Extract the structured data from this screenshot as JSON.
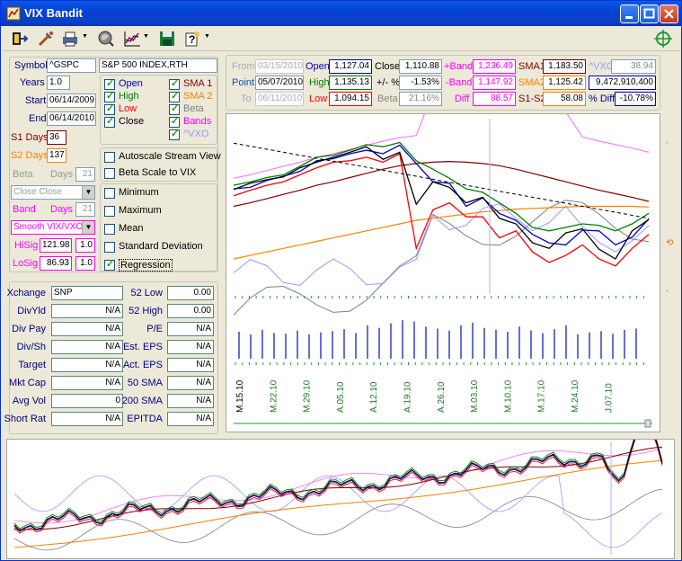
{
  "window": {
    "title": "VIX Bandit"
  },
  "toolbar": {
    "icons": [
      "exit-icon",
      "tools-icon",
      "print-icon",
      "search-globe-icon",
      "chart-icon",
      "save-icon",
      "help-icon",
      "compass-icon"
    ]
  },
  "inputs": {
    "symbol_label": "Symbol",
    "symbol": "^GSPC",
    "name": "S&P 500 INDEX,RTH",
    "years_label": "Years",
    "years": "1.0",
    "start_label": "Start",
    "start": "06/14/2009",
    "end_label": "End",
    "end": "06/14/2010",
    "s1days_label": "S1 Days",
    "s1days": "36",
    "s2days_label": "S2 Days",
    "s2days": "137",
    "beta_label": "Beta",
    "beta_days_label": "Days",
    "beta_days": "21",
    "close_select": "Close Close",
    "band_label": "Band",
    "band_days_label": "Days",
    "band_days": "21",
    "smooth_select": "Smooth VIX/VXO",
    "hisig_label": "HiSig",
    "hisig": "121.98",
    "hisig_mult": "1.0",
    "losig_label": "LoSig",
    "losig": "86.93",
    "losig_mult": "1.0"
  },
  "checks_col1": [
    {
      "label": "Open",
      "on": true,
      "color": "#0000cc"
    },
    {
      "label": "High",
      "on": true,
      "color": "#008000"
    },
    {
      "label": "Low",
      "on": true,
      "color": "#ff0000"
    },
    {
      "label": "Close",
      "on": true,
      "color": "#000000"
    }
  ],
  "checks_col2": [
    {
      "label": "SMA 1",
      "on": true,
      "color": "#800000"
    },
    {
      "label": "SMA 2",
      "on": true,
      "color": "#ff8000"
    },
    {
      "label": "Beta",
      "on": true,
      "color": "#808080"
    },
    {
      "label": "Bands",
      "on": true,
      "color": "#ff00ff"
    },
    {
      "label": "^VXO",
      "on": true,
      "color": "#9999ff"
    }
  ],
  "options": [
    {
      "label": "Autoscale Stream View",
      "on": false
    },
    {
      "label": "Beta Scale to VIX",
      "on": false
    }
  ],
  "stats_opts": [
    {
      "label": "Minimum",
      "on": false
    },
    {
      "label": "Maximum",
      "on": false
    },
    {
      "label": "Mean",
      "on": false
    },
    {
      "label": "Standard Deviation",
      "on": false
    },
    {
      "label": "Regression",
      "on": true
    }
  ],
  "fundamentals": [
    {
      "l": "Xchange",
      "v": "SNP",
      "l2": "52 Low",
      "v2": "0.00"
    },
    {
      "l": "DivYld",
      "v": "N/A",
      "l2": "52 High",
      "v2": "0.00"
    },
    {
      "l": "Div Pay",
      "v": "N/A",
      "l2": "P/E",
      "v2": "N/A"
    },
    {
      "l": "Div/Sh",
      "v": "N/A",
      "l2": "Est. EPS",
      "v2": "N/A"
    },
    {
      "l": "Target",
      "v": "N/A",
      "l2": "Act. EPS",
      "v2": "N/A"
    },
    {
      "l": "Mkt Cap",
      "v": "N/A",
      "l2": "50 SMA",
      "v2": "N/A"
    },
    {
      "l": "Avg Vol",
      "v": "0",
      "l2": "200 SMA",
      "v2": "N/A"
    },
    {
      "l": "Short Rat",
      "v": "N/A",
      "l2": "EPITDA",
      "v2": "N/A"
    }
  ],
  "quote": {
    "from_label": "From",
    "from": "03/15/2010",
    "point_label": "Point",
    "point": "05/07/2010",
    "to_label": "To",
    "to": "06/11/2010",
    "open_label": "Open",
    "open": "1,127.04",
    "high_label": "High",
    "high": "1,135.13",
    "low_label": "Low",
    "low": "1,094.15",
    "close_label": "Close",
    "close": "1,110.88",
    "pct_label": "+/- %",
    "pct": "-1.53%",
    "beta_label": "Beta",
    "beta": "21.16%",
    "pband_label": "+Band",
    "pband": "1,236.49",
    "mband_label": "-Band",
    "mband": "1,147.92",
    "diff_label": "Diff",
    "diff": "88.57",
    "sma1_label": "SMA1",
    "sma1": "1,183.50",
    "sma2_label": "SMA2",
    "sma2": "1,125.42",
    "s1s2_label": "S1-S2",
    "s1s2": "58.08",
    "vxo_label": "^VXO",
    "vxo": "38.94",
    "volume": "9,472,910,400",
    "pdiff_label": "% Diff",
    "pdiff": "-10.78%"
  },
  "chart_data": {
    "type": "line",
    "x_labels": [
      "M.15.10",
      "M.22.10",
      "M.29.10",
      "A.05.10",
      "A.12.10",
      "A.19.10",
      "A.26.10",
      "M.03.10",
      "M.10.10",
      "M.17.10",
      "M.24.10",
      "J.07.10"
    ],
    "series": [
      {
        "color": "#0000cc",
        "values": [
          1150,
          1152,
          1162,
          1168,
          1175,
          1190,
          1193,
          1200,
          1205,
          1200,
          1212,
          1186,
          1160,
          1158,
          1125,
          1137,
          1115,
          1105,
          1085,
          1073,
          1070,
          1091,
          1090,
          1070,
          1081,
          1107
        ]
      },
      {
        "color": "#008000",
        "values": [
          1155,
          1160,
          1166,
          1170,
          1182,
          1195,
          1198,
          1205,
          1213,
          1210,
          1216,
          1190,
          1178,
          1165,
          1150,
          1145,
          1130,
          1115,
          1095,
          1090,
          1095,
          1100,
          1098,
          1090,
          1100,
          1115
        ]
      },
      {
        "color": "#ff0000",
        "values": [
          1140,
          1148,
          1155,
          1160,
          1170,
          1180,
          1188,
          1190,
          1195,
          1188,
          1200,
          1065,
          1120,
          1130,
          1110,
          1110,
          1080,
          1090,
          1060,
          1045,
          1055,
          1070,
          1050,
          1040,
          1065,
          1085
        ]
      },
      {
        "color": "#000000",
        "values": [
          1149,
          1158,
          1163,
          1167,
          1180,
          1188,
          1195,
          1202,
          1210,
          1192,
          1202,
          1128,
          1160,
          1152,
          1130,
          1138,
          1108,
          1100,
          1073,
          1065,
          1087,
          1093,
          1064,
          1050,
          1090,
          1106
        ]
      }
    ],
    "sma1": [
      1125,
      1130,
      1136,
      1142,
      1148,
      1155,
      1160,
      1166,
      1172,
      1178,
      1183,
      1186,
      1188,
      1189,
      1188,
      1186,
      1183,
      1178,
      1172,
      1166,
      1160,
      1154,
      1148,
      1143,
      1138,
      1132
    ],
    "sma2": [
      1050,
      1055,
      1060,
      1065,
      1070,
      1075,
      1080,
      1085,
      1090,
      1095,
      1100,
      1105,
      1108,
      1111,
      1114,
      1117,
      1119,
      1121,
      1122,
      1123,
      1124,
      1125,
      1125,
      1125,
      1125,
      1124
    ],
    "volume": [
      42,
      38,
      45,
      40,
      39,
      44,
      38,
      41,
      43,
      46,
      40,
      52,
      48,
      55,
      60,
      58,
      50,
      47,
      44,
      52,
      56,
      48,
      45,
      42,
      50,
      44,
      40,
      46,
      52,
      38,
      41,
      43,
      39,
      45,
      47
    ],
    "ylim": [
      1000,
      1250
    ]
  }
}
